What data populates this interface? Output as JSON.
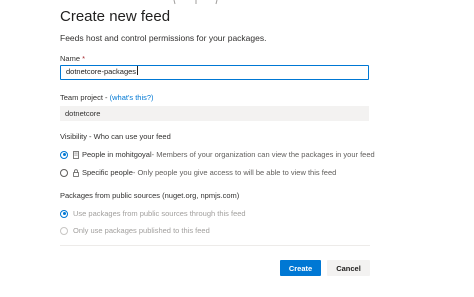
{
  "dialog": {
    "title": "Create new feed",
    "subtitle": "Feeds host and control permissions for your packages."
  },
  "name_field": {
    "label": "Name",
    "required_mark": "*",
    "value": "dotnetcore-packages"
  },
  "team_project": {
    "label": "Team project - ",
    "link": "(what's this?)",
    "value": "dotnetcore"
  },
  "visibility": {
    "label": "Visibility - Who can use your feed",
    "options": [
      {
        "title": "People in mohitgoyal",
        "desc": " - Members of your organization can view the packages in your feed",
        "selected": true,
        "icon": "building-icon"
      },
      {
        "title": "Specific people",
        "desc": " - Only people you give access to will be able to view this feed",
        "selected": false,
        "icon": "lock-icon"
      }
    ]
  },
  "upstream": {
    "label": "Packages from public sources (nuget.org, npmjs.com)",
    "options": [
      {
        "label": "Use packages from public sources through this feed",
        "selected": true,
        "disabled": true
      },
      {
        "label": "Only use packages published to this feed",
        "selected": false,
        "disabled": true
      }
    ]
  },
  "buttons": {
    "create": "Create",
    "cancel": "Cancel"
  },
  "colors": {
    "accent": "#0078d4",
    "required": "#a4262c"
  }
}
